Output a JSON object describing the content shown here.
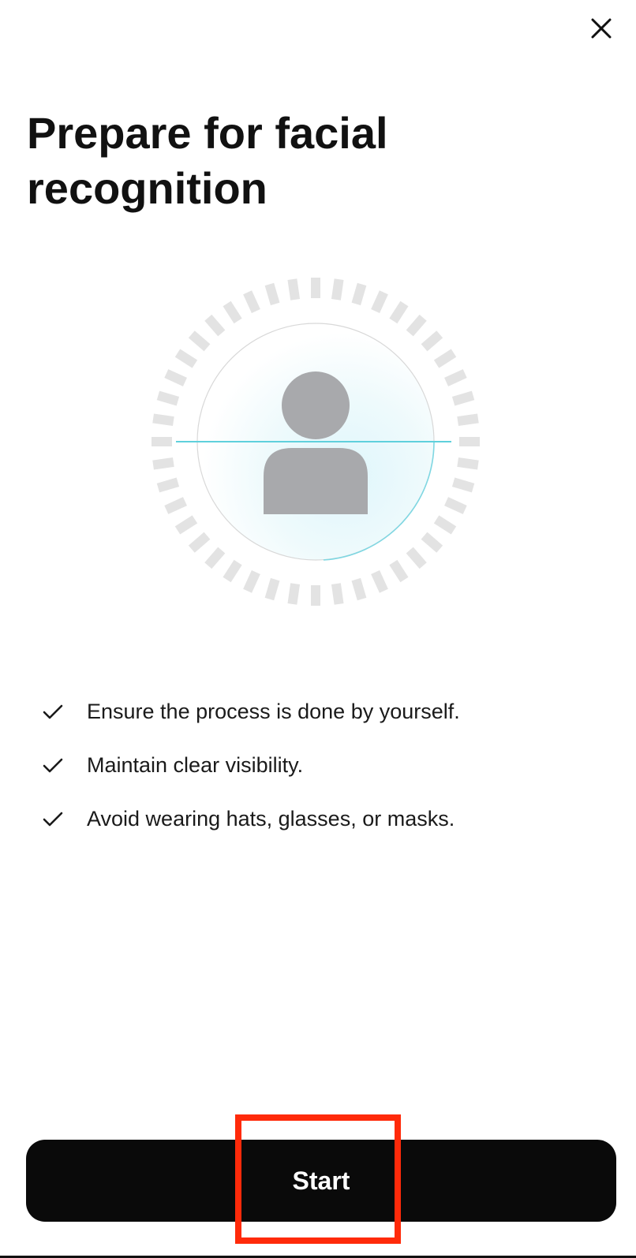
{
  "header": {
    "close_icon": "close-icon"
  },
  "page": {
    "title": "Prepare for facial recognition"
  },
  "illustration": {
    "icon": "face-scan-icon",
    "colors": {
      "tick": "#e3e3e3",
      "avatar": "#a8a9ac",
      "scan_line": "#5fd0dc",
      "glow": "#dff6fb"
    }
  },
  "checklist": {
    "icon": "check-icon",
    "items": [
      "Ensure the process is done by yourself.",
      "Maintain clear visibility.",
      "Avoid wearing hats, glasses, or masks."
    ]
  },
  "actions": {
    "start_label": "Start"
  },
  "colors": {
    "button_bg": "#0a0a0a",
    "button_text": "#ffffff",
    "highlight": "#ff2a0a"
  }
}
